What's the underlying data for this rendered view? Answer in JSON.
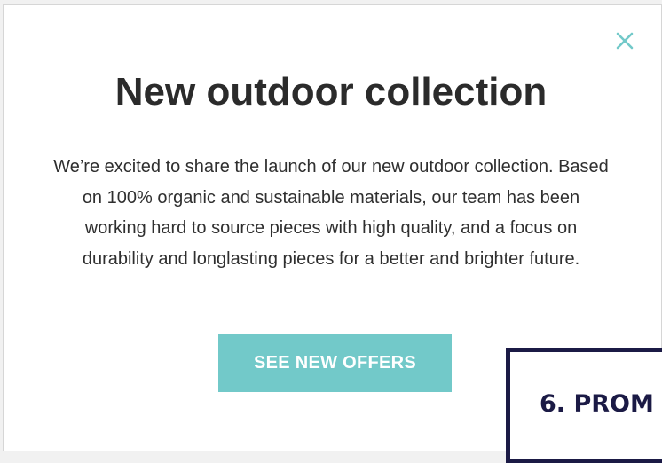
{
  "modal": {
    "close_icon": "close-icon",
    "title": "New outdoor collection",
    "description": "We’re excited to share the launch of our new outdoor collection. Based on 100% organic and sustainable materials, our team has been working hard to source pieces with high quality, and a focus on durability and longlasting pieces for a better and brighter future.",
    "cta_label": "SEE NEW OFFERS"
  },
  "overlay": {
    "label": "6. PROM"
  },
  "colors": {
    "accent": "#72c9c9",
    "title_text": "#2b2b2b",
    "body_text": "#2f2f2f",
    "overlay_border": "#1b1a45",
    "overlay_text": "#1b1a45"
  }
}
